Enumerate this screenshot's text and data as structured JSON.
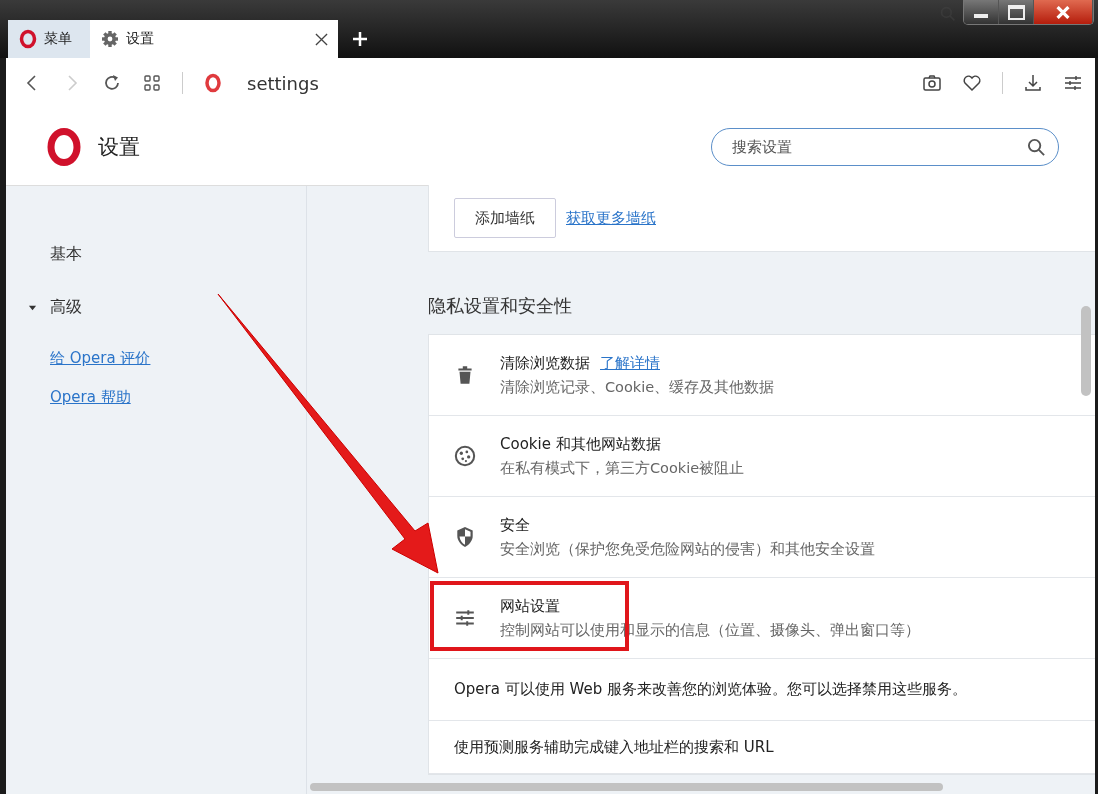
{
  "tabs": [
    {
      "label": "菜单",
      "kind": "menu",
      "selected": false
    },
    {
      "label": "设置",
      "kind": "page",
      "selected": true
    }
  ],
  "address_bar": {
    "value": "settings"
  },
  "header": {
    "title": "设置",
    "search": {
      "placeholder": "搜索设置"
    }
  },
  "sidebar": {
    "items": [
      {
        "label": "基本",
        "kind": "section"
      },
      {
        "label": "高级",
        "kind": "group",
        "expanded": true
      }
    ],
    "links": [
      "给 Opera 评价",
      "Opera 帮助"
    ]
  },
  "wallpaper_card": {
    "button": "添加墙纸",
    "link": "获取更多墙纸"
  },
  "privacy": {
    "title": "隐私设置和安全性",
    "rows": [
      {
        "kind": "trash",
        "title": "清除浏览数据",
        "link": "了解详情",
        "subtitle": "清除浏览记录、Cookie、缓存及其他数据",
        "highlighted": false
      },
      {
        "kind": "cookie",
        "title": "Cookie 和其他网站数据",
        "subtitle": "在私有模式下，第三方Cookie被阻止",
        "highlighted": false
      },
      {
        "kind": "shield",
        "title": "安全",
        "subtitle": "安全浏览（保护您免受危险网站的侵害）和其他安全设置",
        "highlighted": false
      },
      {
        "kind": "sliders",
        "title": "网站设置",
        "subtitle": "控制网站可以使用和显示的信息（位置、摄像头、弹出窗口等）",
        "highlighted": true
      },
      {
        "kind": "text",
        "title": "Opera 可以使用 Web 服务来改善您的浏览体验。您可以选择禁用这些服务。",
        "highlighted": false
      },
      {
        "kind": "text",
        "title": "使用预测服务辅助完成键入地址栏的搜索和 URL",
        "highlighted": false
      }
    ]
  }
}
